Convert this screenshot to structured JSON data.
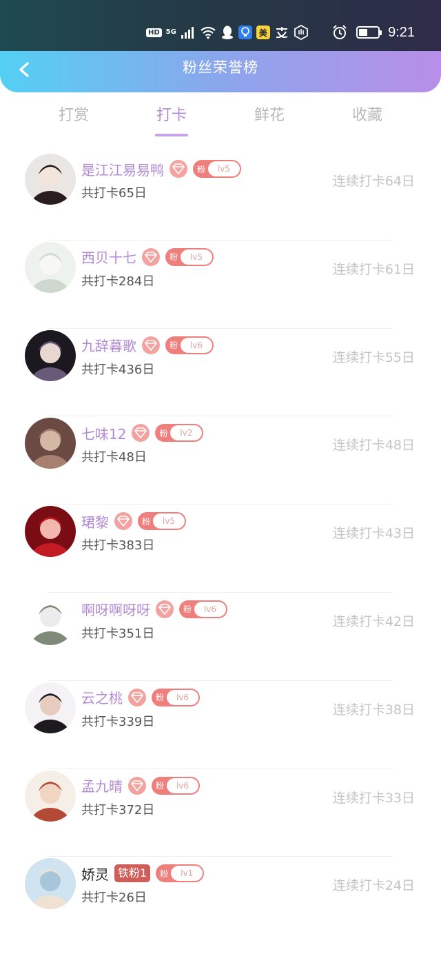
{
  "status_bar": {
    "hd": "HD",
    "network": "5G",
    "meituan": "美",
    "time": "9:21",
    "icons": [
      "hd-icon",
      "signal-icon",
      "wifi-icon",
      "qq-icon",
      "bulb-icon",
      "meituan-icon",
      "alipay-icon",
      "hand-icon",
      "alarm-icon",
      "battery-icon"
    ]
  },
  "nav": {
    "title": "粉丝荣誉榜"
  },
  "tabs": [
    {
      "label": "打赏"
    },
    {
      "label": "打卡"
    },
    {
      "label": "鲜花"
    },
    {
      "label": "收藏"
    }
  ],
  "active_tab": 1,
  "fan_badge_label": "粉",
  "entries": [
    {
      "name": "是江江易易鸭",
      "badge": "diamond",
      "level": "lv5",
      "total": "共打卡65日",
      "streak": "连续打卡64日"
    },
    {
      "name": "西贝十七",
      "badge": "diamond",
      "level": "lv5",
      "total": "共打卡284日",
      "streak": "连续打卡61日"
    },
    {
      "name": "九辞暮歌",
      "badge": "diamond",
      "level": "lv6",
      "total": "共打卡436日",
      "streak": "连续打卡55日"
    },
    {
      "name": "七味12",
      "badge": "diamond",
      "level": "lv2",
      "total": "共打卡48日",
      "streak": "连续打卡48日"
    },
    {
      "name": "珺黎",
      "badge": "diamond",
      "level": "lv5",
      "total": "共打卡383日",
      "streak": "连续打卡43日"
    },
    {
      "name": "啊呀啊呀呀",
      "badge": "diamond",
      "level": "lv6",
      "total": "共打卡351日",
      "streak": "连续打卡42日"
    },
    {
      "name": "云之桃",
      "badge": "diamond",
      "level": "lv6",
      "total": "共打卡339日",
      "streak": "连续打卡38日"
    },
    {
      "name": "孟九晴",
      "badge": "diamond",
      "level": "lv6",
      "total": "共打卡372日",
      "streak": "连续打卡33日"
    },
    {
      "name": "娇灵",
      "badge": "iron",
      "badge_text": "铁粉1",
      "level": "lv1",
      "total": "共打卡26日",
      "streak": "连续打卡24日"
    }
  ],
  "colors": {
    "name": "#b38ad6",
    "accent_tab": "#b48ad6",
    "fan_badge": "#ef7f7c",
    "diamond_badge": "#f2a3a0",
    "iron_badge": "#cf5d58",
    "streak": "#c4c4c4"
  }
}
